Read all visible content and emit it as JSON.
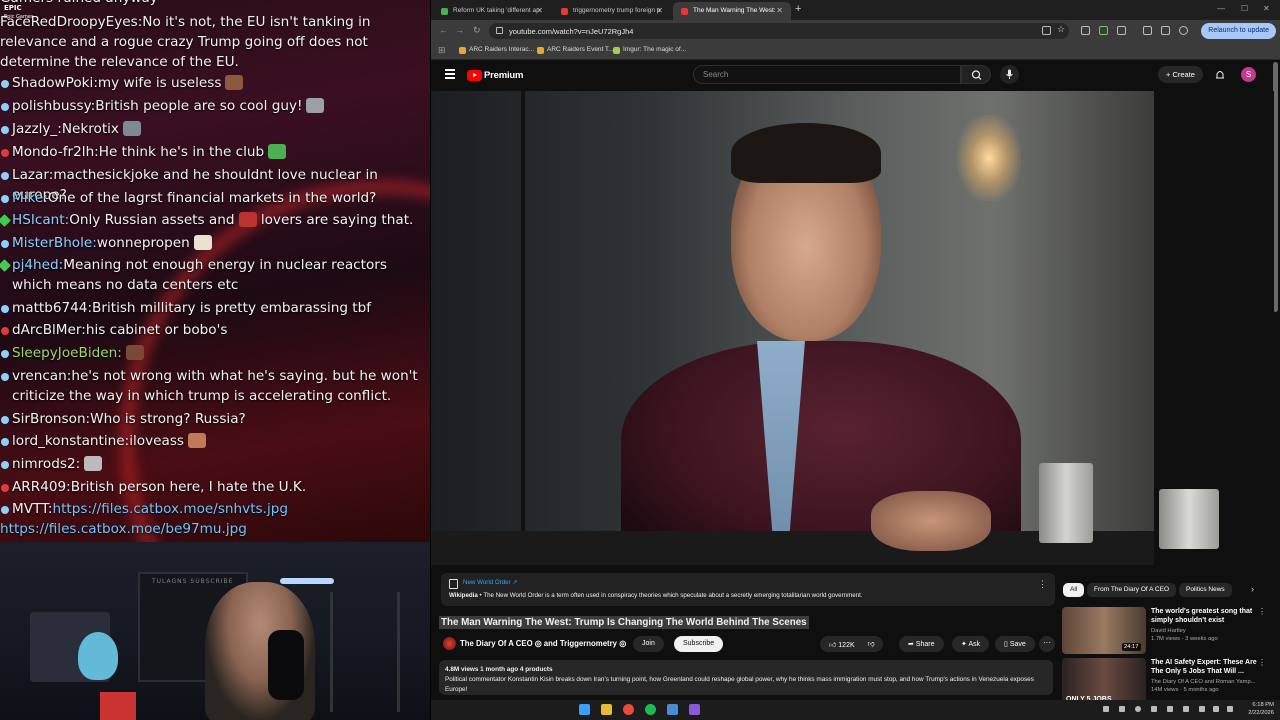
{
  "overlay": {
    "logo_text": "EPIC",
    "logo_subtext": "Epic Games",
    "chat": [
      {
        "badge": "",
        "user": "",
        "message": "Gamers ruined anyway",
        "partial": true
      },
      {
        "badge": "",
        "user": "FaceRedDroopyEyes",
        "message": "No it's not, the EU isn't tanking in relevance and a rogue crazy Trump going off does not determine the relevance of the EU."
      },
      {
        "badge": "blue",
        "user": "ShadowPoki",
        "message": "my wife is useless",
        "emote": "#8b5a3c"
      },
      {
        "badge": "blue",
        "user": "polishbussy",
        "message": "British people are so cool guy!",
        "emote": "#9aa0a6"
      },
      {
        "badge": "blue",
        "user": "Jazzly_",
        "message": "Nekrotix",
        "emote": "#7d8a94"
      },
      {
        "badge": "red",
        "user": "Mondo-fr2lh",
        "message": "He think he's in the club",
        "emote": "#4caf50"
      },
      {
        "badge": "blue",
        "user": "Lazar",
        "message": "macthesickjoke and he shouldnt love nuclear in europe?"
      },
      {
        "badge": "blue",
        "user": "Mike",
        "message": "One of the lagrst financial markets in the world?",
        "user_color": "#8ad1ff"
      },
      {
        "badge": "green",
        "user": "HSIcant",
        "message": "Only Russian assets and",
        "tail": "lovers are saying that.",
        "emote": "#b33",
        "user_color": "#8ad1ff"
      },
      {
        "badge": "blue",
        "user": "MisterBhole",
        "message": "wonnepropen",
        "emote": "#e9e2d0",
        "user_color": "#8ad1ff"
      },
      {
        "badge": "green",
        "user": "pj4hed",
        "message": "Meaning not enough energy in nuclear reactors which means no data centers etc",
        "user_color": "#8ad1ff"
      },
      {
        "badge": "blue",
        "user": "mattb6744",
        "message": "British millitary is pretty embarassing tbf"
      },
      {
        "badge": "red",
        "user": "dArcBlMer",
        "message": "his cabinet or bobo's"
      },
      {
        "badge": "blue",
        "user": "SleepyJoeBiden",
        "message": "",
        "emote": "#7a4a36",
        "user_color": "#9ad76a"
      },
      {
        "badge": "blue",
        "user": "vrencan",
        "message": "he's not wrong with what he's saying. but he won't criticize the way in which trump is accelerating conflict."
      },
      {
        "badge": "blue",
        "user": "SirBronson",
        "message": "Who is strong? Russia?"
      },
      {
        "badge": "blue",
        "user": "lord_konstantine",
        "message": "iloveass",
        "emote": "#c27a56"
      },
      {
        "badge": "blue",
        "user": "nimrods2",
        "message": "",
        "emote": "#bbb"
      },
      {
        "badge": "red",
        "user": "ARR409",
        "message": "British person here, I hate the U.K."
      },
      {
        "badge": "blue",
        "user": "MVTT",
        "message": "",
        "link": "https://files.catbox.moe/snhvts.jpg"
      },
      {
        "badge": "",
        "user": "",
        "message": "",
        "link": "https://files.catbox.moe/be97mu.jpg"
      }
    ],
    "webcam_wall_text": "TULAGNS SUBSCRIBE"
  },
  "browser": {
    "tabs": [
      {
        "title": "Reform UK taking 'different ap",
        "active": false,
        "favicon_color": "#4caf50"
      },
      {
        "title": "triggernometry trump foreign p",
        "active": false,
        "favicon_color": "#e53935"
      },
      {
        "title": "The Man Warning The West:",
        "active": true,
        "favicon_color": "#e53935"
      }
    ],
    "new_tab": "+",
    "url": "youtube.com/watch?v=nJeU72RgJh4",
    "relaunch_label": "Relaunch to update",
    "bookmarks": [
      {
        "label": "ARC Raiders Interac..."
      },
      {
        "label": "ARC Raiders Event T..."
      },
      {
        "label": "Imgur: The magic of..."
      }
    ]
  },
  "youtube": {
    "logo_text": "Premium",
    "search_placeholder": "Search",
    "create_label": "Create",
    "avatar_letter": "S",
    "info_card": {
      "title": "New World Order",
      "source": "Wikipedia",
      "text": "The New World Order is a term often used in conspiracy theories which speculate about a secretly emerging totalitarian world government."
    },
    "video_title": "The Man Warning The West: Trump Is Changing The World Behind The Scenes",
    "channel": "The Diary Of A CEO",
    "channel_join": "and",
    "channel_2": "Triggernometry",
    "join_label": "Join",
    "subscribe_label": "Subscribe",
    "likes": "122K",
    "share_label": "Share",
    "ask_label": "Ask",
    "save_label": "Save",
    "more_label": "···",
    "description": {
      "meta": "4.8M views  1 month ago  4 products",
      "text": "Political commentator Konstantin Kisin breaks down Iran's turning point, how Greenland could reshape global power, why he thinks mass immigration must stop, and how Trump's actions in Venezuela exposes Europe!"
    },
    "chips": [
      "All",
      "From The Diary Of A CEO",
      "Politics News"
    ],
    "recommendations": [
      {
        "title": "The world's greatest song that simply shouldn't exist",
        "channel": "David Hartley",
        "meta": "1.7M views · 3 weeks ago",
        "duration": "24:17",
        "thumb": "#7a5a48"
      },
      {
        "title": "The AI Safety Expert: These Are The Only 5 Jobs That Will ...",
        "channel": "The Diary Of A CEO and Roman Yamp...",
        "meta": "14M views · 5 months ago",
        "duration": "",
        "thumb": "#3a3232",
        "thumb_text": "ONLY 5 JOBS"
      }
    ]
  },
  "taskbar": {
    "time": "6:18 PM",
    "date": "2/22/2026"
  }
}
